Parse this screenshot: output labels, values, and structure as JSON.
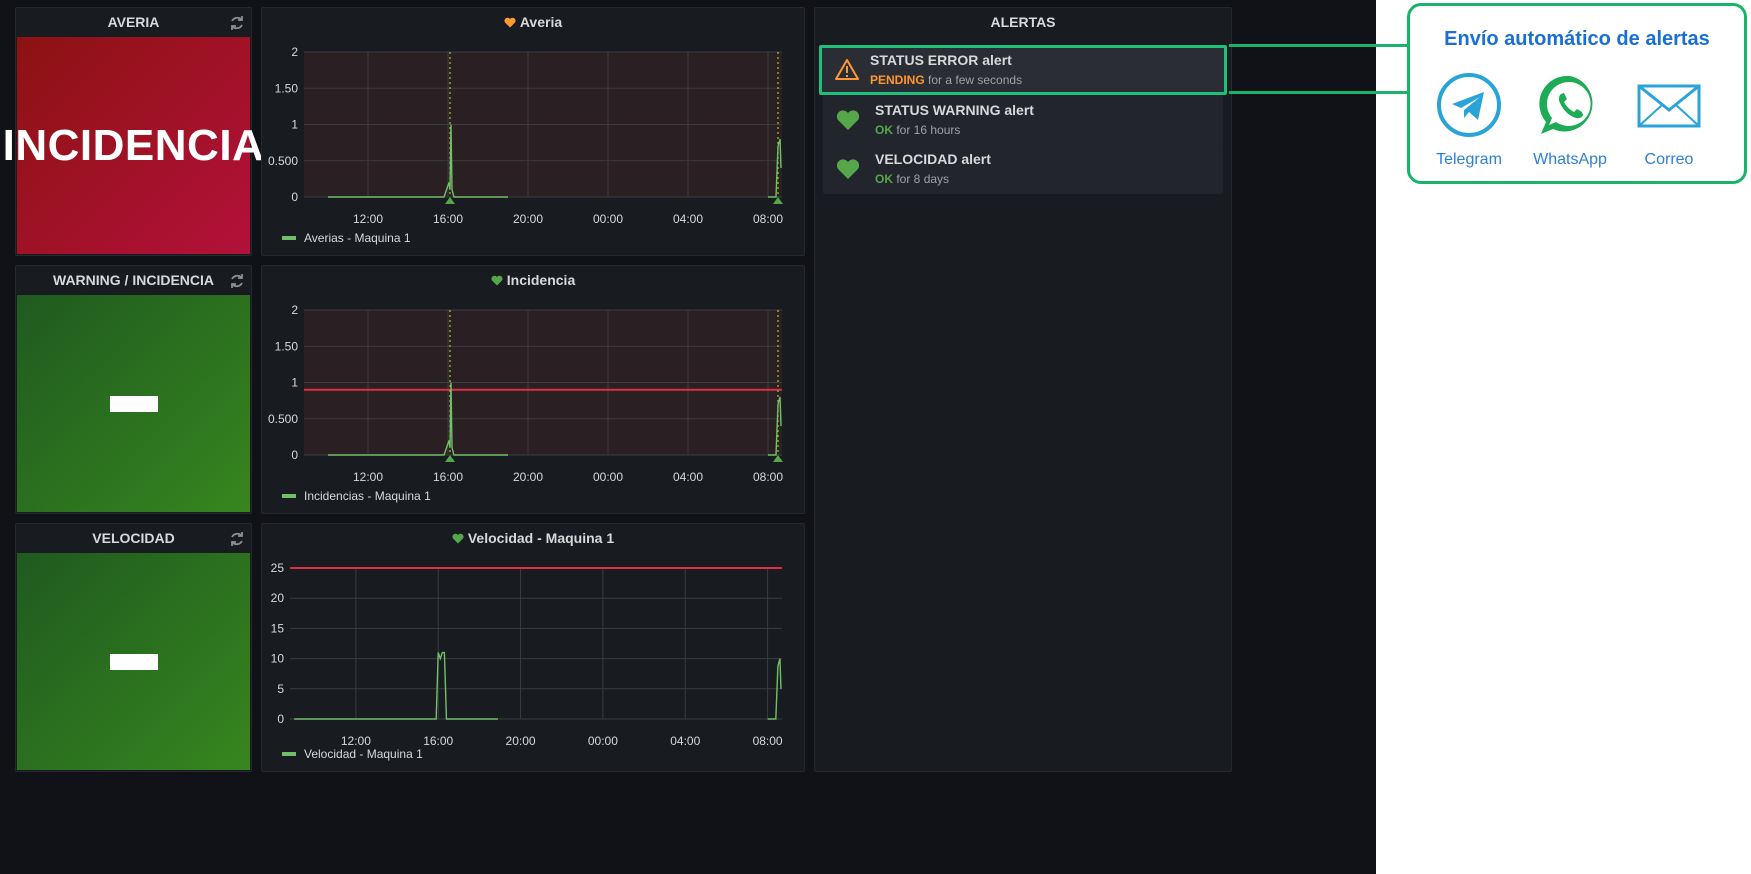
{
  "panels": {
    "averia_stat": {
      "title": "AVERIA",
      "value": "INCIDENCIA"
    },
    "warning_stat": {
      "title": "WARNING / INCIDENCIA"
    },
    "velocidad_stat": {
      "title": "VELOCIDAD"
    },
    "averia_graph": {
      "title": "Averia",
      "legend": "Averias - Maquina 1"
    },
    "incidencia_graph": {
      "title": "Incidencia",
      "legend": "Incidencias - Maquina 1"
    },
    "velocidad_graph": {
      "title": "Velocidad - Maquina 1",
      "legend": "Velocidad - Maquina 1"
    }
  },
  "alerts": {
    "title": "ALERTAS",
    "items": [
      {
        "name": "STATUS ERROR alert",
        "state": "PENDING",
        "duration": "for a few seconds",
        "icon": "warning-icon"
      },
      {
        "name": "STATUS WARNING alert",
        "state": "OK",
        "duration": "for 16 hours",
        "icon": "heart-icon"
      },
      {
        "name": "VELOCIDAD alert",
        "state": "OK",
        "duration": "for 8 days",
        "icon": "heart-icon"
      }
    ]
  },
  "callout": {
    "title": "Envío automático de alertas",
    "channels": [
      {
        "label": "Telegram",
        "icon": "telegram-icon"
      },
      {
        "label": "WhatsApp",
        "icon": "whatsapp-icon"
      },
      {
        "label": "Correo",
        "icon": "mail-icon"
      }
    ]
  },
  "colors": {
    "accent_green": "#19b36b",
    "callout_blue": "#1a6fd6",
    "series": "#73bf69",
    "threshold": "#e02f44",
    "pending": "#ff9830",
    "ok": "#56a64b"
  },
  "chart_data": [
    {
      "type": "line",
      "title": "Averia",
      "xticks": [
        "12:00",
        "16:00",
        "20:00",
        "00:00",
        "04:00",
        "08:00"
      ],
      "yticks": [
        "0",
        "0.500",
        "1",
        "1.50",
        "2"
      ],
      "ylim": [
        0,
        2
      ],
      "series": [
        {
          "name": "Averias - Maquina 1",
          "x": [
            10.0,
            15.8,
            16.05,
            16.1,
            16.15,
            16.2,
            16.3,
            19.0
          ],
          "y": [
            0,
            0,
            0.2,
            0.1,
            1,
            0.1,
            0,
            0
          ]
        }
      ]
    },
    {
      "type": "line",
      "title": "Incidencia",
      "xticks": [
        "12:00",
        "16:00",
        "20:00",
        "00:00",
        "04:00",
        "08:00"
      ],
      "yticks": [
        "0",
        "0.500",
        "1",
        "1.50",
        "2"
      ],
      "ylim": [
        0,
        2
      ],
      "threshold": 0.9,
      "series": [
        {
          "name": "Incidencias - Maquina 1",
          "x": [
            10.0,
            15.8,
            16.05,
            16.1,
            16.15,
            16.2,
            16.3,
            19.0
          ],
          "y": [
            0,
            0,
            0.2,
            0.1,
            1,
            0.1,
            0,
            0
          ]
        }
      ]
    },
    {
      "type": "line",
      "title": "Velocidad - Maquina 1",
      "xticks": [
        "12:00",
        "16:00",
        "20:00",
        "00:00",
        "04:00",
        "08:00"
      ],
      "yticks": [
        "0",
        "5",
        "10",
        "15",
        "20",
        "25"
      ],
      "ylim": [
        0,
        25
      ],
      "threshold": 25,
      "series": [
        {
          "name": "Velocidad - Maquina 1",
          "x": [
            9.0,
            15.9,
            16.0,
            16.1,
            16.2,
            16.3,
            16.4,
            18.9
          ],
          "y": [
            0,
            0,
            11,
            10,
            11,
            11,
            0,
            0
          ]
        }
      ]
    }
  ]
}
